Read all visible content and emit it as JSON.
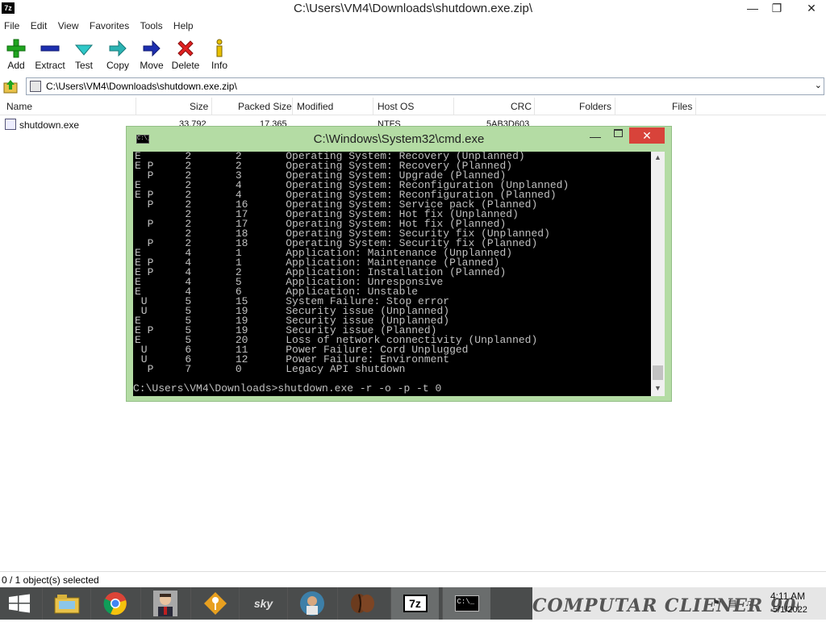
{
  "window": {
    "title": "C:\\Users\\VM4\\Downloads\\shutdown.exe.zip\\",
    "app_icon_text": "7z",
    "controls": {
      "minimize": "—",
      "maximize": "❐",
      "close": "✕"
    }
  },
  "menu": [
    "File",
    "Edit",
    "View",
    "Favorites",
    "Tools",
    "Help"
  ],
  "toolbar": {
    "add": "Add",
    "extract": "Extract",
    "test": "Test",
    "copy": "Copy",
    "move": "Move",
    "delete": "Delete",
    "info": "Info"
  },
  "address": {
    "path": "C:\\Users\\VM4\\Downloads\\shutdown.exe.zip\\"
  },
  "columns": {
    "name": "Name",
    "size": "Size",
    "packed": "Packed Size",
    "modified": "Modified",
    "host_os": "Host OS",
    "crc": "CRC",
    "folders": "Folders",
    "files": "Files"
  },
  "file_row": {
    "name": "shutdown.exe",
    "size": "33,792",
    "packed": "17,365",
    "host_os": "NTFS",
    "crc": "5AB3D603"
  },
  "status": {
    "text": "0 / 1 object(s) selected"
  },
  "cmd": {
    "title": "C:\\Windows\\System32\\cmd.exe",
    "icon_text": "C:\\_",
    "lines": [
      "E       2       2       Operating System: Recovery (Unplanned)",
      "E P     2       2       Operating System: Recovery (Planned)",
      "  P     2       3       Operating System: Upgrade (Planned)",
      "E       2       4       Operating System: Reconfiguration (Unplanned)",
      "E P     2       4       Operating System: Reconfiguration (Planned)",
      "  P     2       16      Operating System: Service pack (Planned)",
      "        2       17      Operating System: Hot fix (Unplanned)",
      "  P     2       17      Operating System: Hot fix (Planned)",
      "        2       18      Operating System: Security fix (Unplanned)",
      "  P     2       18      Operating System: Security fix (Planned)",
      "E       4       1       Application: Maintenance (Unplanned)",
      "E P     4       1       Application: Maintenance (Planned)",
      "E P     4       2       Application: Installation (Planned)",
      "E       4       5       Application: Unresponsive",
      "E       4       6       Application: Unstable",
      " U      5       15      System Failure: Stop error",
      " U      5       19      Security issue (Unplanned)",
      "E       5       19      Security issue (Unplanned)",
      "E P     5       19      Security issue (Planned)",
      "E       5       20      Loss of network connectivity (Unplanned)",
      " U      6       11      Power Failure: Cord Unplugged",
      " U      6       12      Power Failure: Environment",
      "  P     7       0       Legacy API shutdown"
    ],
    "prompt": "C:\\Users\\VM4\\Downloads>shutdown.exe -r -o -p -t 0"
  },
  "taskbar": {
    "tray_text": "COMPUTAR CLIENER 900",
    "time": "4:11 AM",
    "date": "5/1/2022",
    "z_button_text": "7z",
    "cmd_button_text": "C:\\_",
    "sky_text": "sky"
  },
  "colors": {
    "cmd_frame": "#b4dca4",
    "cmd_close": "#d8433a",
    "taskbar": "#4a4c4c"
  }
}
